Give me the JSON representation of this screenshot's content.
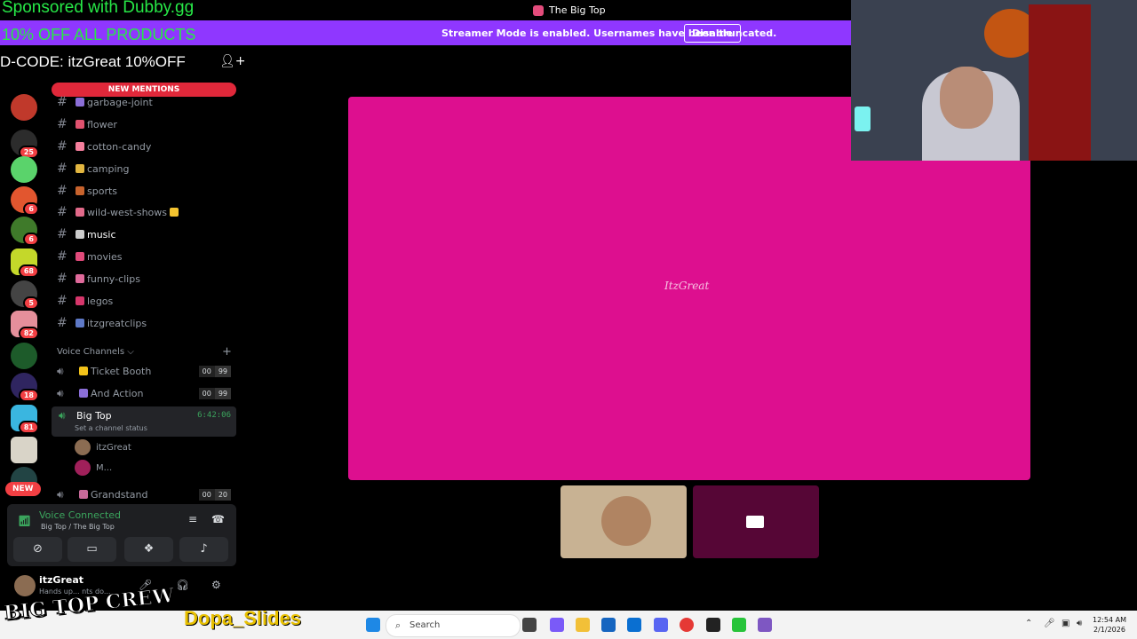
{
  "window": {
    "title": "The Big Top"
  },
  "streamer_banner": {
    "message": "Streamer Mode is enabled. Usernames have been truncated.",
    "disable_label": "Disable"
  },
  "overlay": {
    "sponsor_line1": "Sponsored with Dubby.gg",
    "sponsor_line2": "10% OFF ALL PRODUCTS",
    "sponsor_line3": "D-CODE: itzGreat 10%OFF",
    "logo_text": "BIG TOP CREW",
    "dopa_text": "Dopa_Slides"
  },
  "server_rail": {
    "badges": [
      "25",
      "6",
      "6",
      "68",
      "5",
      "82",
      "18",
      "81"
    ],
    "new_label": "NEW"
  },
  "sidebar": {
    "new_mentions_label": "NEW MENTIONS",
    "channels": [
      {
        "name": "garbage-joint"
      },
      {
        "name": "flower"
      },
      {
        "name": "cotton-candy"
      },
      {
        "name": "camping"
      },
      {
        "name": "sports"
      },
      {
        "name": "wild-west-shows"
      },
      {
        "name": "music"
      },
      {
        "name": "movies"
      },
      {
        "name": "funny-clips"
      },
      {
        "name": "legos"
      },
      {
        "name": "itzgreatclips"
      }
    ],
    "voice_header": "Voice Channels",
    "voice_channels": [
      {
        "name": "Ticket Booth",
        "count_a": "00",
        "count_b": "99"
      },
      {
        "name": "And Action",
        "count_a": "00",
        "count_b": "99"
      },
      {
        "name": "Big Top",
        "timer": "6:42:06",
        "status": "Set a channel status"
      },
      {
        "name": "Grandstand",
        "count_a": "00",
        "count_b": "20"
      }
    ],
    "members": [
      {
        "name": "itzGreat"
      },
      {
        "name": "M..."
      }
    ]
  },
  "voice_panel": {
    "status": "Voice Connected",
    "subtitle": "Big Top / The Big Top"
  },
  "user": {
    "name": "itzGreat",
    "status": "Hands up... nts do..."
  },
  "stage": {
    "watermark": "ItzGreat"
  },
  "taskbar": {
    "search_placeholder": "Search",
    "time": "12:54 AM",
    "date": "2/1/2026"
  },
  "colors": {
    "stage_bg": "#dd0f8f",
    "banner_bg": "#8f37ff",
    "sponsor_green": "#27e847",
    "mention_red": "#e0283a"
  }
}
